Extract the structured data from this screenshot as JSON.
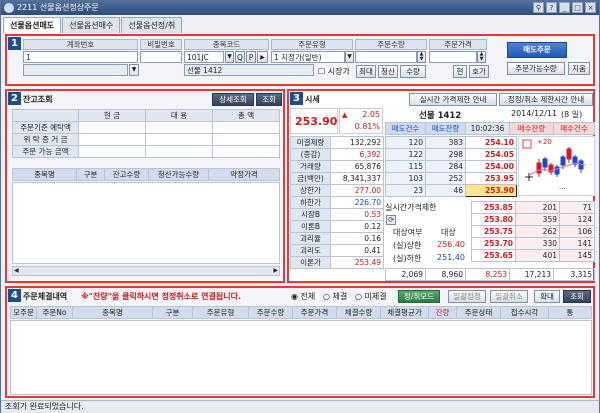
{
  "window": {
    "title": "2211 선물옵션정상주문"
  },
  "tabs": [
    {
      "label": "선물옵션매도"
    },
    {
      "label": "선물옵션매수"
    },
    {
      "label": "선물옵션정/취"
    }
  ],
  "order": {
    "h_account": "계좌번호",
    "h_password": "비밀번호",
    "h_code": "종목코드",
    "h_type": "주문유형",
    "h_qty": "주문수량",
    "h_price": "주문가격",
    "account_value": "1",
    "code_value": "101JC",
    "code_q": "Q",
    "code_p": "P",
    "code_next": "▶",
    "type_value": "1 지정가(일반)",
    "product_name": "선물 1412",
    "market_price_label": "시장가",
    "max_btn": "최대",
    "clear_btn": "청산",
    "qty_btn": "수량",
    "cur_btn": "현",
    "quote_btn": "호가",
    "submit_btn": "매도주문",
    "possible_btn": "주문가능수량",
    "init_btn": "지움"
  },
  "balance": {
    "title": "잔고조회",
    "detail_btn": "상세조회",
    "query_btn": "조회",
    "h_cash": "현 금",
    "h_sub": "대 용",
    "h_total": "총 액",
    "rows": [
      {
        "label": "주문기준 예탁액"
      },
      {
        "label": "위 탁 증 거 금"
      },
      {
        "label": "주문 가능 금액"
      }
    ],
    "cols": [
      "종목명",
      "구분",
      "잔고수량",
      "청산가능수량",
      "약정가격"
    ]
  },
  "quote": {
    "title": "시세",
    "limit_btn": "실시간 가격제한 안내",
    "cancel_btn": "정정/취소 제한시간 안내",
    "price": "253.90",
    "arrow": "▲",
    "change": "2.05",
    "change_pct": "0.81%",
    "product": "선물 1412",
    "date": "2014/12/11",
    "day": "(8 일)",
    "col_h": [
      "매도건수",
      "매도잔량",
      "10:02:36",
      "매수잔량",
      "매수건수"
    ],
    "stats": [
      {
        "label": "미결제량",
        "value": "132,292",
        "cls": ""
      },
      {
        "label": "(증감)",
        "value": "6,392",
        "cls": "redt"
      },
      {
        "label": "거래량",
        "value": "65,876",
        "cls": ""
      },
      {
        "label": "금(백만)",
        "value": "8,341,337",
        "cls": ""
      },
      {
        "label": "상한가",
        "value": "277.00",
        "cls": "redt"
      },
      {
        "label": "하한가",
        "value": "226.70",
        "cls": "bluet"
      },
      {
        "label": "시장B",
        "value": "0.53",
        "cls": "redt"
      },
      {
        "label": "이론B",
        "value": "0.12",
        "cls": ""
      },
      {
        "label": "괴리율",
        "value": "0.16",
        "cls": ""
      },
      {
        "label": "괴리도",
        "value": "0.41",
        "cls": ""
      },
      {
        "label": "이론가",
        "value": "253.49",
        "cls": "redt"
      }
    ],
    "asks": [
      {
        "cnt": "120",
        "qty": "383",
        "price": "254.10"
      },
      {
        "cnt": "122",
        "qty": "298",
        "price": "254.05"
      },
      {
        "cnt": "115",
        "qty": "284",
        "price": "254.00"
      },
      {
        "cnt": "103",
        "qty": "252",
        "price": "253.95"
      },
      {
        "cnt": "23",
        "qty": "46",
        "price": "253.90"
      }
    ],
    "bids": [
      {
        "price": "253.85",
        "qty": "201",
        "cnt": "71"
      },
      {
        "price": "253.80",
        "qty": "359",
        "cnt": "124"
      },
      {
        "price": "253.75",
        "qty": "262",
        "cnt": "106"
      },
      {
        "price": "253.70",
        "qty": "330",
        "cnt": "141"
      },
      {
        "price": "253.65",
        "qty": "401",
        "cnt": "145"
      }
    ],
    "rt_limit_label": "실시간가격제한",
    "target_label": "대상여부",
    "target_value": "대상",
    "real_upper_label": "(실)상한",
    "real_upper_value": "256.40",
    "real_lower_label": "(실)하한",
    "real_lower_value": "251.40",
    "tot_ask_cnt": "2,069",
    "tot_ask_qty": "8,960",
    "tot_diff": "8,253",
    "tot_bid_qty": "17,213",
    "tot_bid_cnt": "3,315",
    "mini_label": "+20",
    "chart_dots": "..."
  },
  "fills": {
    "title": "주문체결내역",
    "notice": "※\"잔량\"을 클릭하시면 정정취소로 연결됩니다.",
    "radio_all": "전체",
    "radio_filled": "체결",
    "radio_unfilled": "미체결",
    "amend_btn": "정/취모드",
    "batch_amend_btn": "일괄정정",
    "batch_cancel_btn": "일괄취소",
    "expand_btn": "확대",
    "query_btn": "조회",
    "cols": [
      "모주문",
      "주문No",
      "종목명",
      "구분",
      "주문유형",
      "주문수량",
      "주문가격",
      "체결수량",
      "체결평균가",
      "잔량",
      "주문상태",
      "접수시각",
      "통"
    ]
  },
  "status": {
    "message": "조회가 완료되었습니다."
  }
}
